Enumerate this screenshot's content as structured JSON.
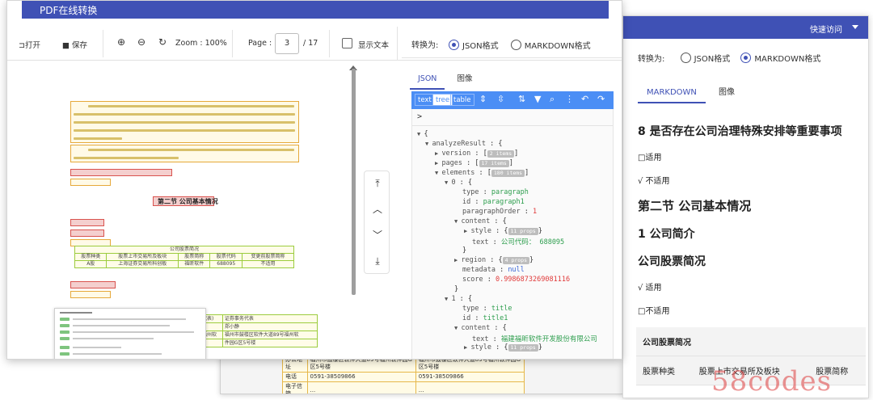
{
  "main_window": {
    "title": "PDF在线转换",
    "toolbar": {
      "open_label": "打开",
      "save_label": "保存",
      "zoom_label": "Zoom :",
      "zoom_value": "100%",
      "page_label": "Page :",
      "page_value": "3",
      "page_total": "/ 17",
      "show_text_label": "显示文本"
    },
    "right_pane": {
      "convert_label": "转换为:",
      "format_json": "JSON格式",
      "format_markdown": "MARKDOWN格式",
      "selected_format": "JSON格式",
      "tabs": [
        "JSON",
        "图像"
      ],
      "active_tab": "JSON",
      "json_modes": [
        "text",
        "tree",
        "table"
      ],
      "active_json_mode": "tree",
      "json_root_arrow": ">",
      "tree": {
        "root_key": "analyzeResult",
        "version_key": "version",
        "version_badge": "2 items",
        "pages_key": "pages",
        "pages_badge": "17 items",
        "elements_key": "elements",
        "elements_badge": "180 items",
        "item0_index": "0",
        "item0_type_key": "type",
        "item0_type": "paragraph",
        "item0_id_key": "id",
        "item0_id": "paragraph1",
        "item0_order_key": "paragraphOrder",
        "item0_order": "1",
        "item0_content_key": "content",
        "item0_style_key": "style",
        "item0_style_badge": "11 props",
        "item0_text_key": "text",
        "item0_text": "公司代码： 688095",
        "item0_region_key": "region",
        "item0_region_badge": "4 props",
        "item0_metadata_key": "metadata",
        "item0_metadata": "null",
        "item0_score_key": "score",
        "item0_score": "0.9986873269081116",
        "item1_index": "1",
        "item1_type_key": "type",
        "item1_type": "title",
        "item1_id_key": "id",
        "item1_id": "title1",
        "item1_content_key": "content",
        "item1_text_key": "text",
        "item1_text": "福建福昕软件开发股份有限公司",
        "item1_style_key": "style",
        "item1_style_badge": "11 props"
      }
    },
    "document": {
      "section_title": "第二节 公司基本情况",
      "table_header": "公司股票简况",
      "table_cols": [
        "股票种类",
        "股票上市交易所及板块",
        "股票简称",
        "股票代码",
        "变更前股票简称"
      ],
      "table_row": [
        "A股",
        "上海证券交易所科创板",
        "福昕软件",
        "688095",
        "不适用"
      ],
      "lower_table": [
        [
          "代表)",
          "证券事务代表"
        ],
        [
          "",
          "郑小静"
        ],
        [
          "福州软",
          "福州市鼓楼区软件大道89号福州软"
        ],
        [
          "",
          "件园G区5号楼"
        ]
      ]
    }
  },
  "back_window": {
    "rows": [
      [
        "办公地址",
        "福州市鼓楼区软件大道89号福州软件园G区5号楼",
        "福州市鼓楼区软件大道89号福州软件园G区5号楼"
      ],
      [
        "电话",
        "0591-38509866",
        "0591-38509866"
      ],
      [
        "电子信箱",
        "...",
        "..."
      ]
    ]
  },
  "right_window": {
    "quick_access": "快速访问",
    "convert_label": "转换为:",
    "format_json": "JSON格式",
    "format_markdown": "MARKDOWN格式",
    "selected_format": "MARKDOWN格式",
    "tabs": [
      "MARKDOWN",
      "图像"
    ],
    "active_tab": "MARKDOWN",
    "markdown": {
      "h_item8": "8 是否存在公司治理特殊安排等重要事项",
      "applicable": "□适用",
      "not_applicable": "√ 不适用",
      "h_section2": "第二节 公司基本情况",
      "h_intro": "1 公司简介",
      "h_stock": "公司股票简况",
      "applicable2": "√ 适用",
      "not_applicable2": "□不适用",
      "table_title": "公司股票简况",
      "table_cols": [
        "股票种类",
        "股票上市交易所及板块",
        "股票简称"
      ]
    }
  },
  "watermark": "58codes",
  "colors": {
    "header_blue": "#3f51b5",
    "json_bar_blue": "#4b8ef5",
    "string_green": "#2e9e4e",
    "number_red": "#e03a3a"
  }
}
